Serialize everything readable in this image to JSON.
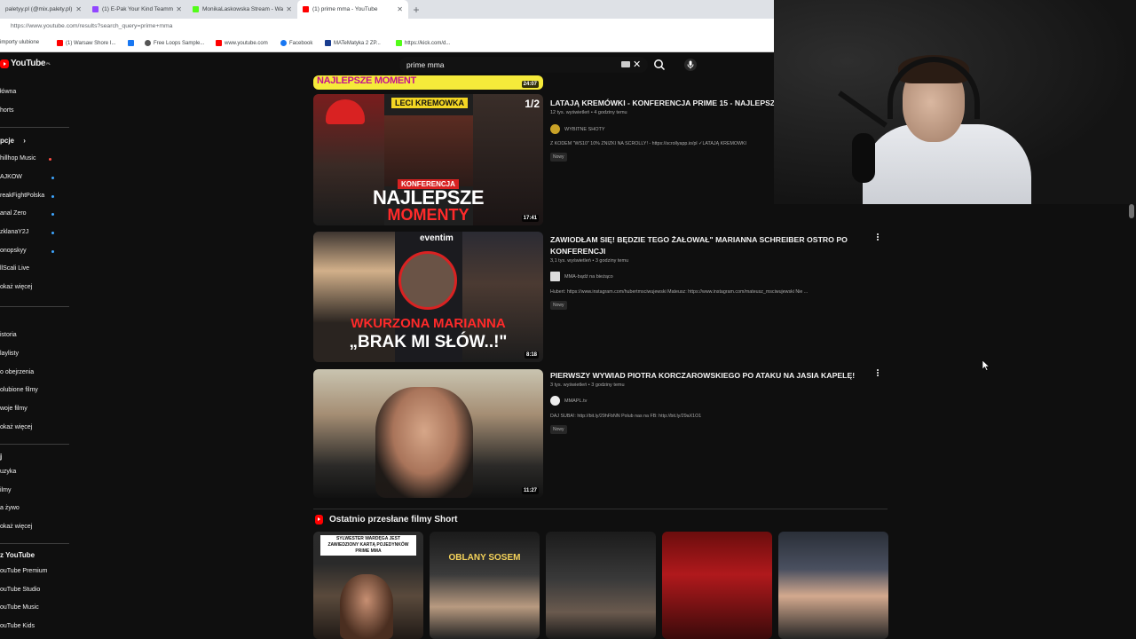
{
  "browser": {
    "tabs": [
      {
        "title": "paletyy.pl (@mix.palety.pl) prez...",
        "favicon_color": "#c13584",
        "active": false
      },
      {
        "title": "(1) E-Pak Your Kind Teammates",
        "favicon_color": "#9146ff",
        "active": false
      },
      {
        "title": "MonikaLaskowska Stream - Watch ...",
        "favicon_color": "#53fc18",
        "active": false
      },
      {
        "title": "(1) prime mma - YouTube",
        "favicon_color": "#ff0000",
        "active": true
      }
    ],
    "new_tab": "+",
    "close_glyph": "✕",
    "url": "https://www.youtube.com/results?search_query=prime+mma",
    "bookmarks": [
      {
        "label": "importy ulubione",
        "color": "#888888"
      },
      {
        "label": "(1) Warsaw Shore I...",
        "color": "#ff0000"
      },
      {
        "label": "",
        "color": "#1877f2"
      },
      {
        "label": "Free Loops Sample...",
        "color": "#555555"
      },
      {
        "label": "www.youtube.com",
        "color": "#ff0000"
      },
      {
        "label": "Facebook",
        "color": "#1877f2"
      },
      {
        "label": "MATeMatyka 2 ZP...",
        "color": "#1a3d8f"
      },
      {
        "label": "https://kick.com/d...",
        "color": "#53fc18"
      }
    ]
  },
  "youtube": {
    "logo_text": "YouTube",
    "country": "PL",
    "search_query": "prime mma",
    "sidebar": {
      "main": [
        "łówna",
        "horts"
      ],
      "subs_header": "pcje",
      "subs_chevron": "›",
      "subs": [
        "hillhop Music",
        "AJKOW",
        "reakFightPolska",
        "anal Zero",
        "zklanaY2J",
        "onopskyy",
        "llScali Live",
        "okaż więcej"
      ],
      "library": [
        "istoria",
        "laylisty",
        "o obejrzenia",
        "olubione filmy",
        "woje filmy",
        "okaż więcej"
      ],
      "explore_header": "j",
      "explore": [
        "uzyka",
        "ilmy",
        "a żywo",
        "okaż więcej"
      ],
      "more_header": "z YouTube",
      "more": [
        "ouTube Premium",
        "ouTube Studio",
        "ouTube Music",
        "ouTube Kids"
      ]
    },
    "prev_result": {
      "thumb_text": "NAJLEPSZE MOMENT",
      "duration": "24:07"
    },
    "results": [
      {
        "title": "LATAJĄ KREMÓWKI - KONFERENCJA PRIME 15 - NAJLEPSZE",
        "meta": "12 tys. wyświetleń • 4 godziny temu",
        "channel": "WYBITNE SHOTY",
        "channel_color": "#c9a227",
        "description": "Z KODEM \"WS10\" 10% ZNIŻKI NA SCROLLY! - https://scrollyapp.io/pl ✓LATAJĄ KREMÓWKI",
        "badge": "Nowy",
        "duration": "17:41",
        "thumb": {
          "corner": "1/2",
          "banner": "LECI KREMOWKA",
          "label": "KONFERENCJA",
          "big1": "NAJLEPSZE",
          "big2": "MOMENTY"
        }
      },
      {
        "title": "ZAWIODŁAM SIĘ! BĘDZIE TEGO ŻAŁOWAŁ\" MARIANNA SCHREIBER OSTRO PO KONFERENCJI",
        "meta": "3,1 tys. wyświetleń • 3 godziny temu",
        "channel": "MMA-bądź na bieżąco",
        "channel_color": "#dddddd",
        "description": "Hubert: https://www.instagram.com/hubertmsciwujewski Mateusz: https://www.instagram.com/mateusz_msciwujewski Nie ...",
        "badge": "Nowy",
        "duration": "8:18",
        "thumb": {
          "brand": "eventim",
          "big1": "WKURZONA MARIANNA",
          "big2": "„BRAK MI SŁÓW..!\""
        }
      },
      {
        "title": "PIERWSZY WYWIAD PIOTRA KORCZAROWSKIEGO PO ATAKU NA JASIA KAPELĘ!",
        "meta": "3 tys. wyświetleń • 3 godziny temu",
        "channel": "MMAPL.tv",
        "channel_color": "#eeeeee",
        "description": "DAJ SUBA!: http://bit.ly/29hFbNN Polub nas na FB: http://bit.ly/29aX1O1",
        "badge": "Nowy",
        "duration": "11:27",
        "thumb": {}
      }
    ],
    "shorts": {
      "heading": "Ostatnio przesłane filmy Short",
      "items": [
        {
          "caption": "SYLWESTER WARDĘGA JEST ZAWIEDZIONY KARTĄ POJEDYNKÓW PRIME MMA"
        },
        {
          "caption": "OBLANY SOSEM"
        },
        {
          "caption": ""
        },
        {
          "caption": ""
        },
        {
          "caption": ""
        }
      ]
    }
  }
}
